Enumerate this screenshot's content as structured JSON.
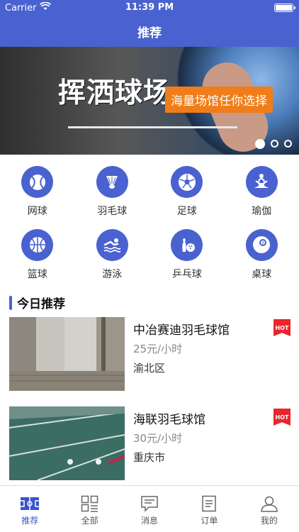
{
  "status": {
    "carrier": "Carrier",
    "time": "11:39 PM"
  },
  "navbar": {
    "title": "推荐"
  },
  "banner": {
    "title": "挥洒球场",
    "tagline": "海量场馆任你选择",
    "dots": 3,
    "active_dot": 1
  },
  "categories": [
    {
      "label": "网球",
      "icon": "tennis-ball-icon"
    },
    {
      "label": "羽毛球",
      "icon": "shuttlecock-icon"
    },
    {
      "label": "足球",
      "icon": "soccer-ball-icon"
    },
    {
      "label": "瑜伽",
      "icon": "yoga-icon"
    },
    {
      "label": "篮球",
      "icon": "basketball-icon"
    },
    {
      "label": "游泳",
      "icon": "swimming-icon"
    },
    {
      "label": "乒乓球",
      "icon": "bowling-icon"
    },
    {
      "label": "桌球",
      "icon": "billiard-ball-icon"
    }
  ],
  "section": {
    "title": "今日推荐"
  },
  "venues": [
    {
      "name": "中冶赛迪羽毛球馆",
      "price": "25元/小时",
      "area": "渝北区",
      "badge": "HOT"
    },
    {
      "name": "海联羽毛球馆",
      "price": "30元/小时",
      "area": "重庆市",
      "badge": "HOT"
    }
  ],
  "tabs": [
    {
      "label": "推荐",
      "icon": "court-icon",
      "active": true
    },
    {
      "label": "全部",
      "icon": "grid-list-icon",
      "active": false
    },
    {
      "label": "消息",
      "icon": "message-icon",
      "active": false
    },
    {
      "label": "订单",
      "icon": "order-icon",
      "active": false
    },
    {
      "label": "我的",
      "icon": "user-icon",
      "active": false
    }
  ],
  "colors": {
    "primary": "#4a62d0",
    "hot": "#e8262c",
    "tagline_bg": "#f07d19"
  }
}
